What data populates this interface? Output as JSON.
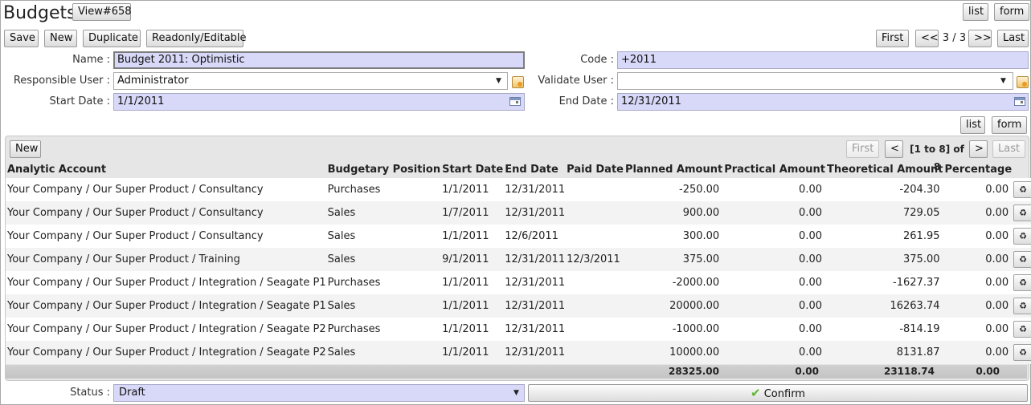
{
  "header": {
    "title": "Budgets",
    "view_badge": "View#658",
    "list_btn": "list",
    "form_btn": "form"
  },
  "toolbar": {
    "save": "Save",
    "new": "New",
    "duplicate": "Duplicate",
    "readonly": "Readonly/Editable"
  },
  "pager": {
    "first": "First",
    "prev": "<<",
    "position": "3 / 3",
    "next": ">>",
    "last": "Last"
  },
  "form": {
    "name_label": "Name :",
    "name_value": "Budget 2011: Optimistic",
    "code_label": "Code :",
    "code_value": "+2011",
    "responsible_label": "Responsible User :",
    "responsible_value": "Administrator",
    "validate_label": "Validate User :",
    "validate_value": "",
    "start_label": "Start Date :",
    "start_value": "1/1/2011",
    "end_label": "End Date :",
    "end_value": "12/31/2011"
  },
  "lines_view": {
    "list_btn": "list",
    "form_btn": "form"
  },
  "lines": {
    "new": "New",
    "pager": {
      "first": "First",
      "prev": "<",
      "range": "[1 to 8] of 8",
      "next": ">",
      "last": "Last"
    },
    "columns": [
      "Analytic Account",
      "Budgetary Position",
      "Start Date",
      "End Date",
      "Paid Date",
      "Planned Amount",
      "Practical Amount",
      "Theoretical Amount",
      "Percentage"
    ],
    "rows": [
      [
        "Your Company / Our Super Product / Consultancy",
        "Purchases",
        "1/1/2011",
        "12/31/2011",
        "",
        "-250.00",
        "0.00",
        "-204.30",
        "0.00"
      ],
      [
        "Your Company / Our Super Product / Consultancy",
        "Sales",
        "1/7/2011",
        "12/31/2011",
        "",
        "900.00",
        "0.00",
        "729.05",
        "0.00"
      ],
      [
        "Your Company / Our Super Product / Consultancy",
        "Sales",
        "1/1/2011",
        "12/6/2011",
        "",
        "300.00",
        "0.00",
        "261.95",
        "0.00"
      ],
      [
        "Your Company / Our Super Product / Training",
        "Sales",
        "9/1/2011",
        "12/31/2011",
        "12/3/2011",
        "375.00",
        "0.00",
        "375.00",
        "0.00"
      ],
      [
        "Your Company / Our Super Product / Integration / Seagate P1",
        "Purchases",
        "1/1/2011",
        "12/31/2011",
        "",
        "-2000.00",
        "0.00",
        "-1627.37",
        "0.00"
      ],
      [
        "Your Company / Our Super Product / Integration / Seagate P1",
        "Sales",
        "1/1/2011",
        "12/31/2011",
        "",
        "20000.00",
        "0.00",
        "16263.74",
        "0.00"
      ],
      [
        "Your Company / Our Super Product / Integration / Seagate P2",
        "Purchases",
        "1/1/2011",
        "12/31/2011",
        "",
        "-1000.00",
        "0.00",
        "-814.19",
        "0.00"
      ],
      [
        "Your Company / Our Super Product / Integration / Seagate P2",
        "Sales",
        "1/1/2011",
        "12/31/2011",
        "",
        "10000.00",
        "0.00",
        "8131.87",
        "0.00"
      ]
    ],
    "row_action_icon": "recycle-icon",
    "totals": {
      "planned": "28325.00",
      "practical": "0.00",
      "theoretical": "23118.74",
      "percentage": "0.00"
    }
  },
  "footer": {
    "status_label": "Status :",
    "status_value": "Draft",
    "confirm": "Confirm",
    "confirm_icon": "checkmark-icon"
  },
  "colors": {
    "field_bg": "#d8d8f8",
    "accent_check": "#5cb82c"
  }
}
